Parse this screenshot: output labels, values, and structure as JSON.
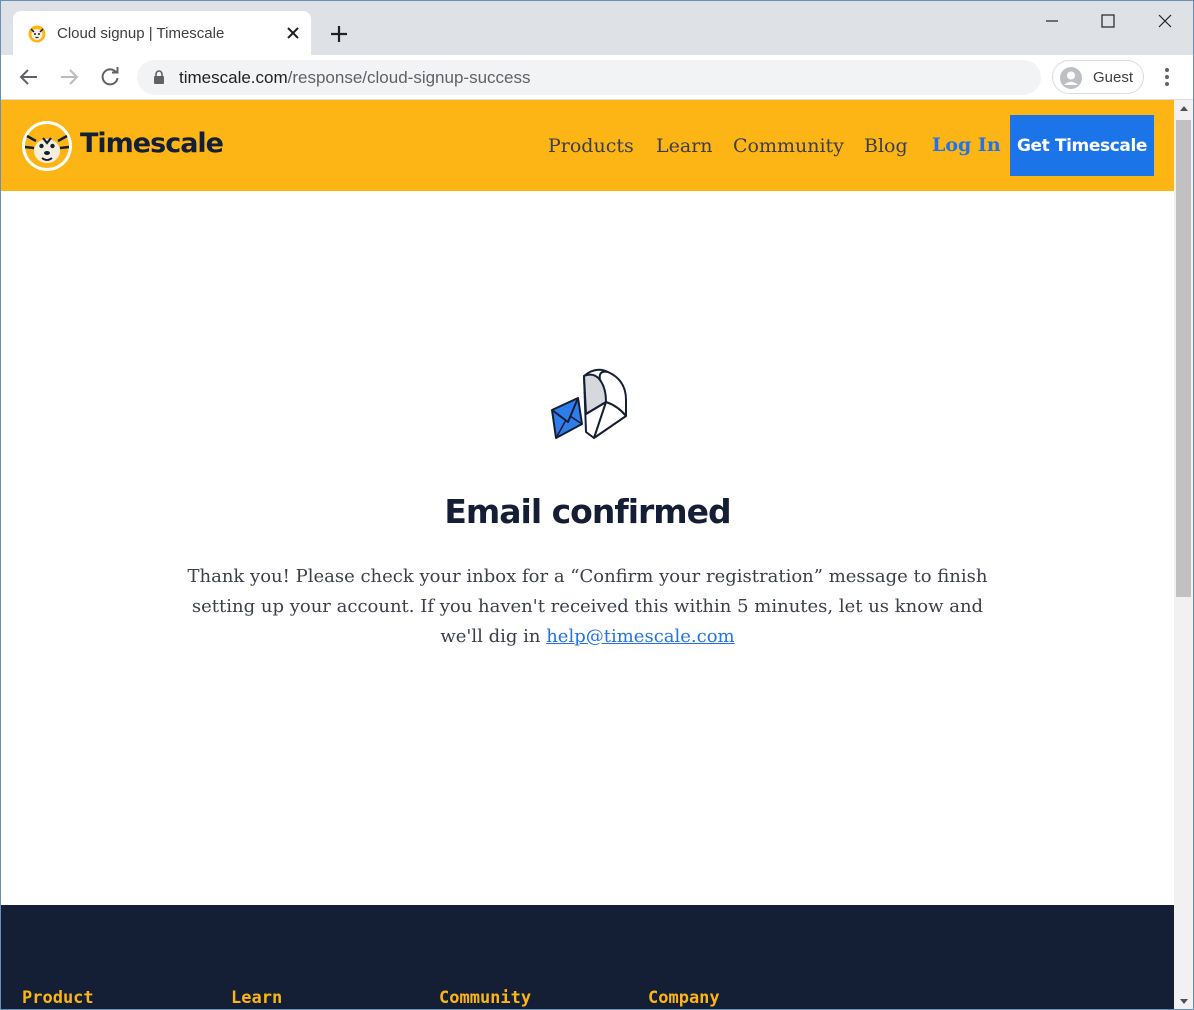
{
  "browser": {
    "tab_title": "Cloud signup | Timescale",
    "url_host": "timescale.com",
    "url_path": "/response/cloud-signup-success",
    "profile_name": "Guest"
  },
  "site": {
    "logo_text": "Timescale",
    "brand_color": "#fdb515",
    "nav": {
      "products": "Products",
      "learn": "Learn",
      "community": "Community",
      "blog": "Blog",
      "login": "Log In",
      "cta": "Get Timescale"
    }
  },
  "main": {
    "icon": "mailbox-icon",
    "title": "Email confirmed",
    "body_before_link": "Thank you! Please check your inbox for a “Confirm your registration” message to finish setting up your account. If you haven't received this within 5 minutes, let us know and we'll dig in ",
    "email_link": "help@timescale.com"
  },
  "footer": {
    "columns": [
      "Product",
      "Learn",
      "Community",
      "Company"
    ]
  }
}
